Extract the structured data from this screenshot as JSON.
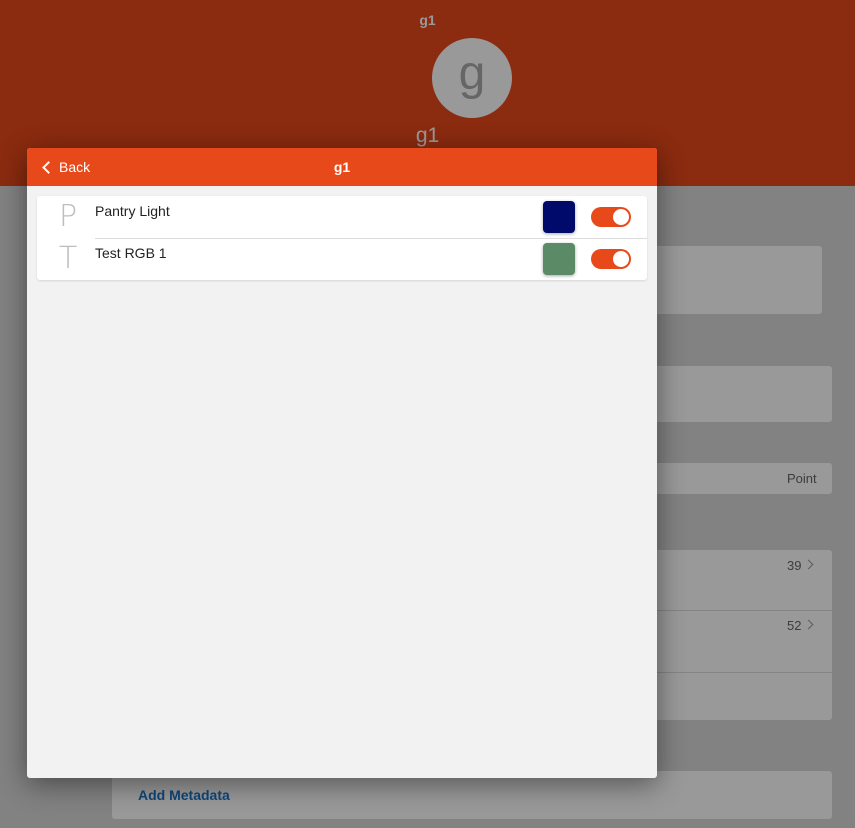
{
  "background": {
    "title_top": "g1",
    "avatar_letter": "g",
    "name": "g1",
    "point_label": "Point",
    "count_1": "39",
    "count_2": "52",
    "add_metadata": "Add Metadata"
  },
  "modal": {
    "back_label": "Back",
    "title": "g1",
    "items": [
      {
        "initial": "P",
        "label": "Pantry Light",
        "color": "#000a6b",
        "enabled": true
      },
      {
        "initial": "T",
        "label": "Test RGB 1",
        "color": "#5b8a66",
        "enabled": true
      }
    ]
  },
  "colors": {
    "accent": "#e8491a"
  }
}
